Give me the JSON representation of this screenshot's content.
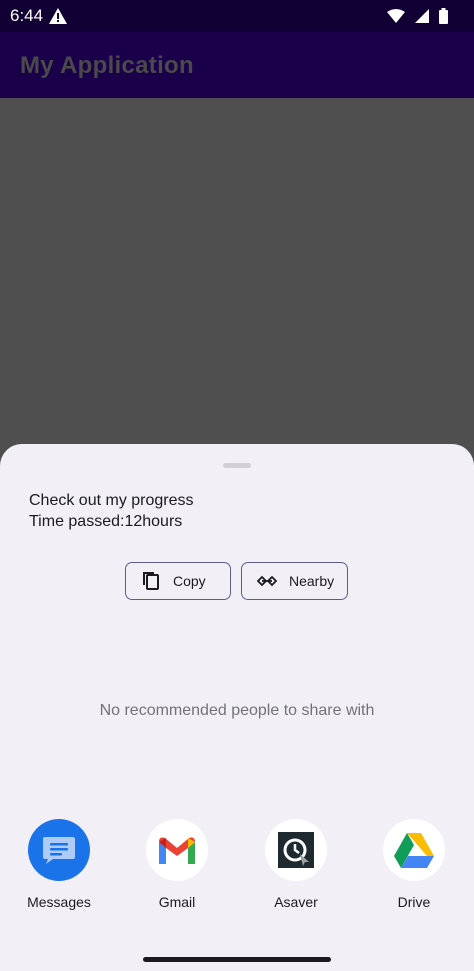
{
  "status_bar": {
    "time": "6:44"
  },
  "app_bar": {
    "title": "My Application"
  },
  "share_sheet": {
    "text_lines": [
      "Check out my progress",
      "Time passed:12hours"
    ],
    "actions": {
      "copy_label": "Copy",
      "nearby_label": "Nearby"
    },
    "empty_message": "No recommended people to share with",
    "targets": [
      {
        "label": "Messages",
        "icon": "messages-icon"
      },
      {
        "label": "Gmail",
        "icon": "gmail-icon"
      },
      {
        "label": "Asaver",
        "icon": "asaver-icon"
      },
      {
        "label": "Drive",
        "icon": "drive-icon"
      }
    ]
  },
  "colors": {
    "status_bar": "#110033",
    "app_bar": "#1a004a",
    "scrim": "#4f4f4f",
    "sheet_bg": "#f2f0f6",
    "button_outline": "#5b5e8c",
    "messages_blue": "#1a73e8"
  }
}
